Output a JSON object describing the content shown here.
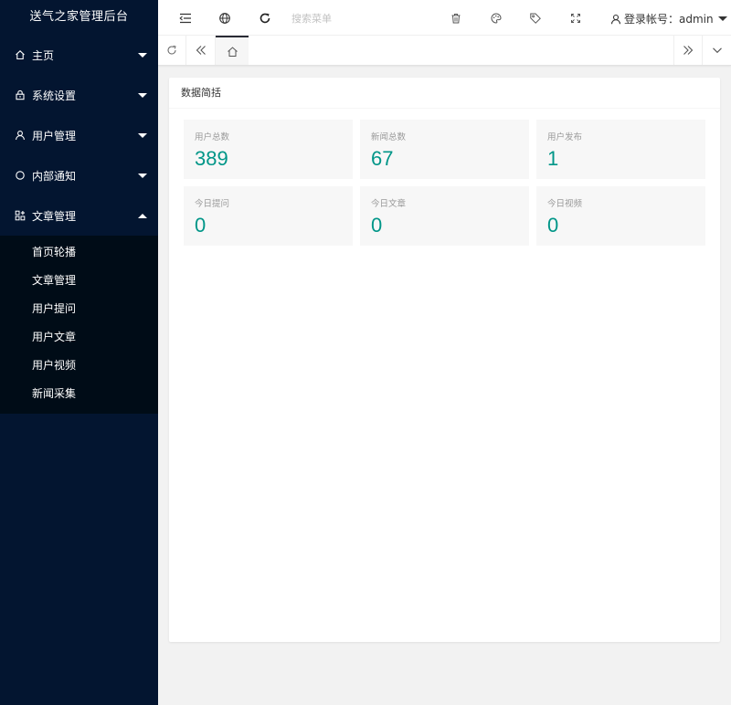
{
  "app": {
    "title": "送气之家管理后台"
  },
  "sidebar": {
    "items": [
      {
        "label": "主页",
        "icon": "home-icon",
        "expanded": false
      },
      {
        "label": "系统设置",
        "icon": "lock-icon",
        "expanded": false
      },
      {
        "label": "用户管理",
        "icon": "user-icon",
        "expanded": false
      },
      {
        "label": "内部通知",
        "icon": "circle-icon",
        "expanded": false
      },
      {
        "label": "文章管理",
        "icon": "apps-icon",
        "expanded": true
      }
    ],
    "submenu": [
      "首页轮播",
      "文章管理",
      "用户提问",
      "用户文章",
      "用户视频",
      "新闻采集"
    ]
  },
  "header": {
    "search_placeholder": "搜索菜单",
    "user_label": "登录帐号：admin",
    "icons": [
      "menu-collapse-icon",
      "globe-icon",
      "refresh-icon",
      "trash-icon",
      "palette-icon",
      "tag-icon",
      "fullscreen-icon",
      "user-icon"
    ]
  },
  "main": {
    "card_title": "数据简括",
    "stats": [
      {
        "label": "用户总数",
        "value": "389"
      },
      {
        "label": "新闻总数",
        "value": "67"
      },
      {
        "label": "用户发布",
        "value": "1"
      },
      {
        "label": "今日提问",
        "value": "0"
      },
      {
        "label": "今日文章",
        "value": "0"
      },
      {
        "label": "今日视频",
        "value": "0"
      }
    ]
  },
  "colors": {
    "sidebar_bg": "#031530",
    "submenu_bg": "#000c17",
    "accent": "#009688"
  }
}
